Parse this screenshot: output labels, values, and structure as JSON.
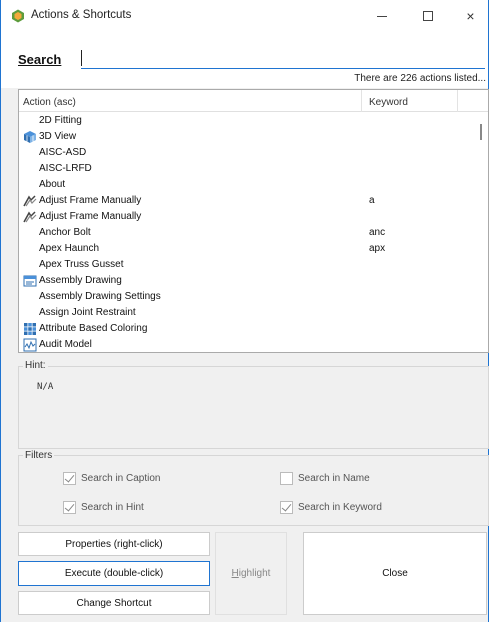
{
  "window": {
    "title": "Actions & Shortcuts",
    "icon": "hexagon-app-icon",
    "controls": {
      "minimize": "minimize-icon",
      "maximize": "maximize-icon",
      "close": "×"
    }
  },
  "search": {
    "label": "Search",
    "value": "",
    "count_text": "There are 226 actions listed..."
  },
  "list": {
    "columns": {
      "action": "Action (asc)",
      "keyword": "Keyword"
    },
    "rows": [
      {
        "label": "2D Fitting",
        "keyword": "",
        "icon": ""
      },
      {
        "label": "3D View",
        "keyword": "",
        "icon": "3d-view-icon"
      },
      {
        "label": "AISC-ASD",
        "keyword": "",
        "icon": ""
      },
      {
        "label": "AISC-LRFD",
        "keyword": "",
        "icon": ""
      },
      {
        "label": "About",
        "keyword": "",
        "icon": ""
      },
      {
        "label": "Adjust Frame Manually",
        "keyword": "a",
        "icon": "adjust-frame-icon"
      },
      {
        "label": "Adjust Frame Manually",
        "keyword": "",
        "icon": "adjust-frame-icon"
      },
      {
        "label": "Anchor Bolt",
        "keyword": "anc",
        "icon": ""
      },
      {
        "label": "Apex Haunch",
        "keyword": "apx",
        "icon": ""
      },
      {
        "label": "Apex Truss Gusset",
        "keyword": "",
        "icon": ""
      },
      {
        "label": "Assembly Drawing",
        "keyword": "",
        "icon": "assembly-drawing-icon"
      },
      {
        "label": "Assembly Drawing Settings",
        "keyword": "",
        "icon": ""
      },
      {
        "label": "Assign Joint Restraint",
        "keyword": "",
        "icon": ""
      },
      {
        "label": "Attribute Based Coloring",
        "keyword": "",
        "icon": "attribute-coloring-icon"
      },
      {
        "label": "Audit Model",
        "keyword": "",
        "icon": "audit-model-icon"
      }
    ]
  },
  "hint": {
    "label": "Hint:",
    "value": "N/A"
  },
  "filters": {
    "label": "Filters",
    "search_in_caption": {
      "label": "Search in Caption",
      "checked": true
    },
    "search_in_name": {
      "label": "Search in Name",
      "checked": false
    },
    "search_in_hint": {
      "label": "Search in Hint",
      "checked": true
    },
    "search_in_keyword": {
      "label": "Search in Keyword",
      "checked": true
    }
  },
  "buttons": {
    "properties": "Properties (right-click)",
    "execute": "Execute (double-click)",
    "change_shortcut": "Change Shortcut",
    "highlight_first": "H",
    "highlight_rest": "ighlight",
    "close": "Close"
  },
  "colors": {
    "accent": "#1f74d1",
    "app_icon": "#6aa84f"
  }
}
